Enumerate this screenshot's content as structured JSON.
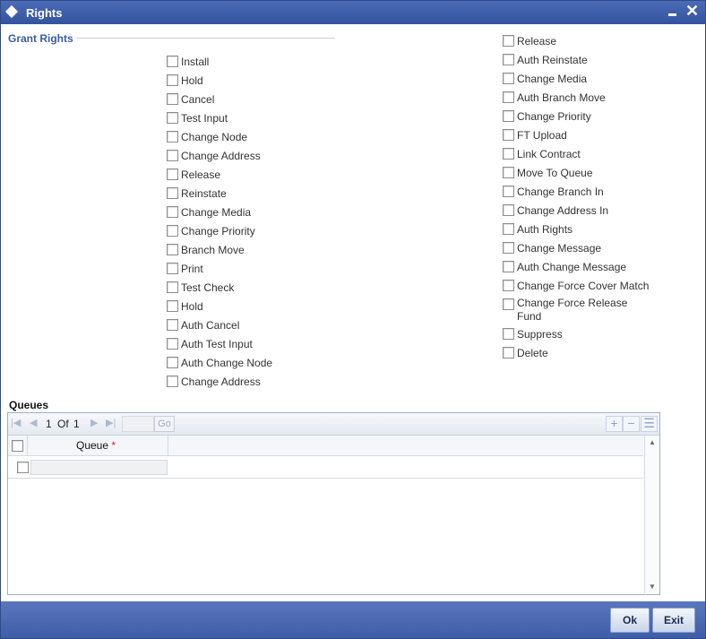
{
  "window": {
    "title": "Rights"
  },
  "grant_rights": {
    "legend": "Grant Rights",
    "col1": [
      "Install",
      "Hold",
      "Cancel",
      "Test Input",
      "Change Node",
      "Change Address",
      "Release",
      "Reinstate",
      "Change Media",
      "Change Priority",
      "Branch Move",
      "Print",
      "Test Check",
      "Hold",
      "Auth Cancel",
      "Auth Test Input",
      "Auth Change Node",
      "Change Address"
    ],
    "col2": [
      "Release",
      "Auth Reinstate",
      "Change Media",
      "Auth Branch Move",
      "Change Priority",
      "FT Upload",
      "Link Contract",
      "Move To Queue",
      "Change Branch In",
      "Change Address In",
      "Auth Rights",
      "Change Message",
      "Auth Change Message",
      "Change Force Cover Match"
    ],
    "col2_wrapped": {
      "line1": "Change Force Release",
      "line2": "Fund"
    },
    "col2_tail": [
      "Suppress",
      "Delete"
    ]
  },
  "queues": {
    "title": "Queues",
    "pager": {
      "current": "1",
      "of": "Of",
      "total": "1",
      "go": "Go"
    },
    "column": "Queue",
    "required_mark": "*"
  },
  "footer": {
    "ok": "Ok",
    "exit": "Exit"
  },
  "icons": [
    "diamond-icon",
    "minimize-icon",
    "close-icon",
    "first-page-icon",
    "prev-page-icon",
    "next-page-icon",
    "last-page-icon",
    "add-row-icon",
    "delete-row-icon",
    "single-view-icon",
    "scroll-up-icon",
    "scroll-down-icon"
  ]
}
